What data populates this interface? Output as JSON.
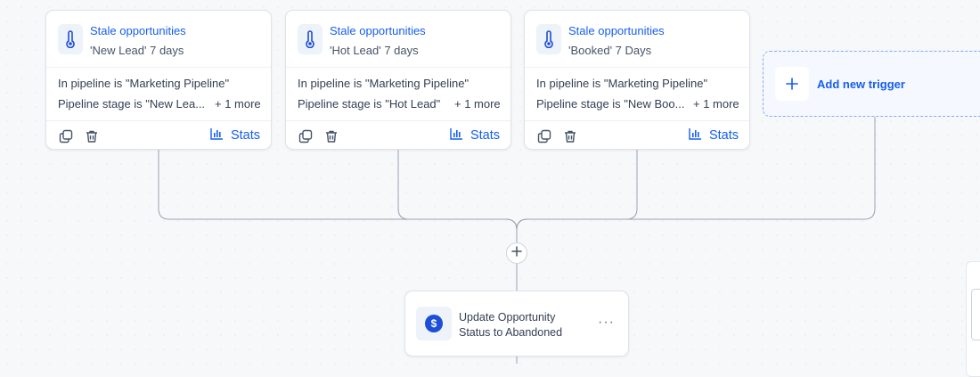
{
  "colors": {
    "accent": "#155eef",
    "card_border": "#dfe3e8",
    "connector": "#98a2b3",
    "action_icon": "#1d4ed8"
  },
  "triggers": [
    {
      "icon": "thermometer-icon",
      "title": "Stale opportunities",
      "subtitle": "'New Lead' 7 days",
      "condition_1": "In pipeline is \"Marketing Pipeline\"",
      "condition_2": "Pipeline stage is \"New Lea...",
      "more": "+ 1 more",
      "stats_label": "Stats"
    },
    {
      "icon": "thermometer-icon",
      "title": "Stale opportunities",
      "subtitle": "'Hot Lead' 7 days",
      "condition_1": "In pipeline is \"Marketing Pipeline\"",
      "condition_2": "Pipeline stage is \"Hot Lead\"",
      "more": "+ 1 more",
      "stats_label": "Stats"
    },
    {
      "icon": "thermometer-icon",
      "title": "Stale opportunities",
      "subtitle": "'Booked' 7 Days",
      "condition_1": "In pipeline is \"Marketing Pipeline\"",
      "condition_2": "Pipeline stage is \"New Boo...",
      "more": "+ 1 more",
      "stats_label": "Stats"
    }
  ],
  "add_trigger": {
    "label": "Add new trigger",
    "icon": "plus-icon"
  },
  "add_step": {
    "icon": "plus-icon"
  },
  "action": {
    "icon": "dollar-icon",
    "icon_glyph": "$",
    "title": "Update Opportunity Status to Abandoned",
    "menu": "···"
  }
}
